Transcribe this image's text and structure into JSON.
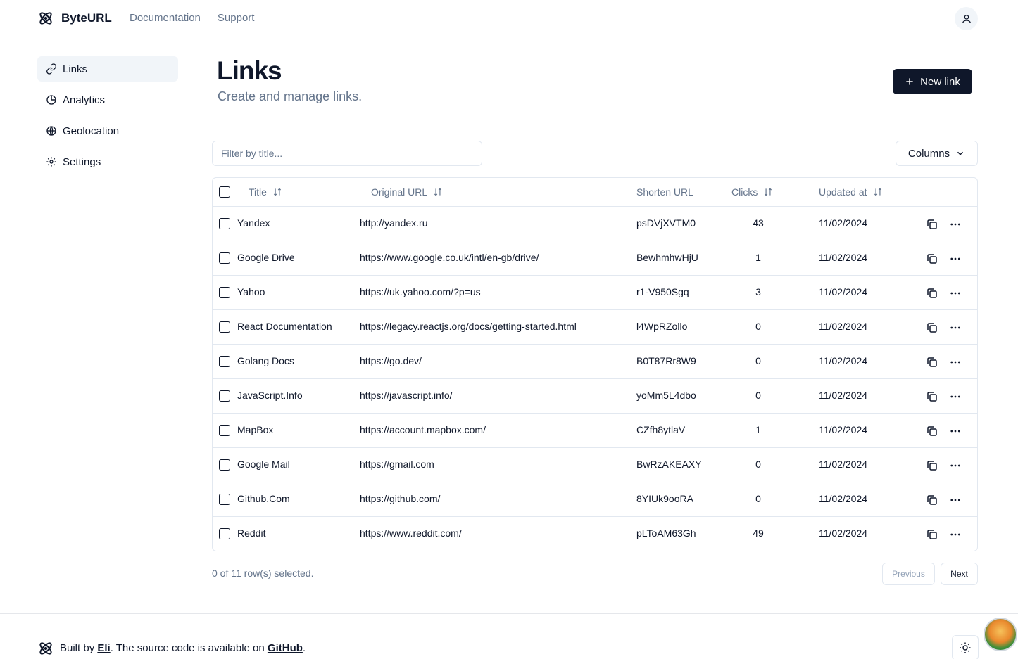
{
  "brand": {
    "name": "ByteURL"
  },
  "topnav": [
    {
      "label": "Documentation"
    },
    {
      "label": "Support"
    }
  ],
  "sidebar": {
    "items": [
      {
        "label": "Links",
        "icon": "link-icon",
        "active": true
      },
      {
        "label": "Analytics",
        "icon": "pie-chart-icon",
        "active": false
      },
      {
        "label": "Geolocation",
        "icon": "globe-icon",
        "active": false
      },
      {
        "label": "Settings",
        "icon": "gear-icon",
        "active": false
      }
    ]
  },
  "main": {
    "title": "Links",
    "subtitle": "Create and manage links.",
    "new_button": "New link",
    "filter_placeholder": "Filter by title...",
    "columns_button": "Columns"
  },
  "table": {
    "headers": {
      "title": "Title",
      "original_url": "Original URL",
      "short_url": "Shorten URL",
      "clicks": "Clicks",
      "updated": "Updated at"
    },
    "rows": [
      {
        "title": "Yandex",
        "url": "http://yandex.ru",
        "short": "psDVjXVTM0",
        "clicks": "43",
        "updated": "11/02/2024"
      },
      {
        "title": "Google Drive",
        "url": "https://www.google.co.uk/intl/en-gb/drive/",
        "short": "BewhmhwHjU",
        "clicks": "1",
        "updated": "11/02/2024"
      },
      {
        "title": "Yahoo",
        "url": "https://uk.yahoo.com/?p=us",
        "short": "r1-V950Sgq",
        "clicks": "3",
        "updated": "11/02/2024"
      },
      {
        "title": "React Documentation",
        "url": "https://legacy.reactjs.org/docs/getting-started.html",
        "short": "l4WpRZollo",
        "clicks": "0",
        "updated": "11/02/2024"
      },
      {
        "title": "Golang Docs",
        "url": "https://go.dev/",
        "short": "B0T87Rr8W9",
        "clicks": "0",
        "updated": "11/02/2024"
      },
      {
        "title": "JavaScript.Info",
        "url": "https://javascript.info/",
        "short": "yoMm5L4dbo",
        "clicks": "0",
        "updated": "11/02/2024"
      },
      {
        "title": "MapBox",
        "url": "https://account.mapbox.com/",
        "short": "CZfh8ytlaV",
        "clicks": "1",
        "updated": "11/02/2024"
      },
      {
        "title": "Google Mail",
        "url": "https://gmail.com",
        "short": "BwRzAKEAXY",
        "clicks": "0",
        "updated": "11/02/2024"
      },
      {
        "title": "Github.Com",
        "url": "https://github.com/",
        "short": "8YIUk9ooRA",
        "clicks": "0",
        "updated": "11/02/2024"
      },
      {
        "title": "Reddit",
        "url": "https://www.reddit.com/",
        "short": "pLToAM63Gh",
        "clicks": "49",
        "updated": "11/02/2024"
      }
    ]
  },
  "pagination": {
    "selection_text": "0 of 11 row(s) selected.",
    "previous": "Previous",
    "next": "Next"
  },
  "footer": {
    "prefix": "Built by ",
    "author": "Eli",
    "middle": ". The source code is available on ",
    "repo": "GitHub",
    "suffix": "."
  },
  "colors": {
    "primary": "#0f172a",
    "muted": "#64748b",
    "border": "#e2e8f0",
    "accent_bg": "#f1f5f9"
  }
}
